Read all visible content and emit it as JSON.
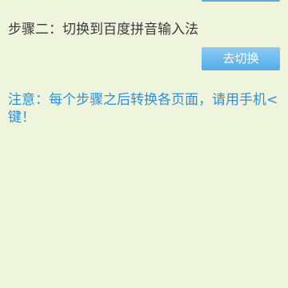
{
  "step": {
    "title": "步骤二：切换到百度拼音输入法"
  },
  "actions": {
    "switch_label": "去切换"
  },
  "note": {
    "text": "注意：每个步骤之后转换各页面，请用手机<键！"
  }
}
